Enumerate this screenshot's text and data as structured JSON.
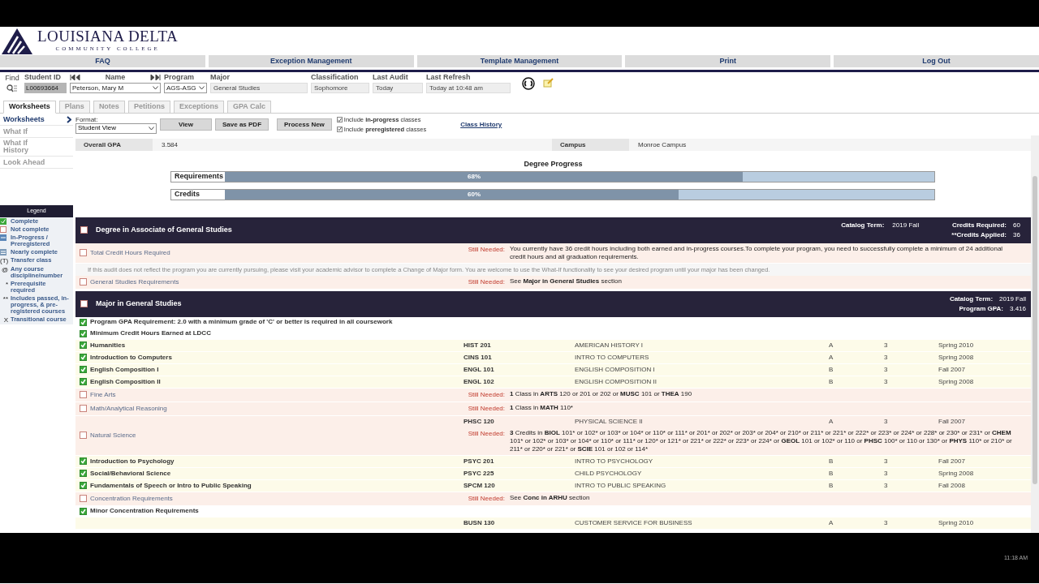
{
  "header": {
    "logo_title": "LOUISIANA DELTA",
    "logo_subtitle": "COMMUNITY COLLEGE"
  },
  "nav": [
    "FAQ",
    "Exception Management",
    "Template Management",
    "Print",
    "Log Out"
  ],
  "student": {
    "find_label": "Find",
    "fields": [
      {
        "label": "Student ID",
        "value": "L00693664",
        "kind": "id"
      },
      {
        "label": "Name",
        "value": "Peterson, Mary M",
        "kind": "select"
      },
      {
        "label": "Program",
        "value": "AGS-ASG",
        "kind": "select"
      },
      {
        "label": "Major",
        "value": "General Studies",
        "kind": "text"
      },
      {
        "label": "Classification",
        "value": "Sophomore",
        "kind": "text"
      },
      {
        "label": "Last Audit",
        "value": "Today",
        "kind": "text"
      },
      {
        "label": "Last Refresh",
        "value": "Today at 10:48 am",
        "kind": "text"
      }
    ]
  },
  "tabs": [
    {
      "label": "Worksheets",
      "selected": true
    },
    {
      "label": "Plans",
      "selected": false
    },
    {
      "label": "Notes",
      "selected": false
    },
    {
      "label": "Petitions",
      "selected": false
    },
    {
      "label": "Exceptions",
      "selected": false
    },
    {
      "label": "GPA Calc",
      "selected": false
    }
  ],
  "side_nav": [
    {
      "label": "Worksheets",
      "selected": true
    },
    {
      "label": "What If",
      "selected": false
    },
    {
      "label": "What If History",
      "selected": false
    },
    {
      "label": "Look Ahead",
      "selected": false
    }
  ],
  "toolbar": {
    "format_label": "Format:",
    "format": "Student View",
    "buttons": [
      "View",
      "Save as PDF",
      "Process New"
    ],
    "options": [
      {
        "text": "Include **in-progress** classes",
        "checked": true
      },
      {
        "text": "Include **preregistered** classes",
        "checked": true
      }
    ],
    "link": "Class History"
  },
  "legend": {
    "title": "Legend",
    "items": [
      {
        "kind": "check",
        "text": "Complete"
      },
      {
        "kind": "box",
        "text": "Not complete"
      },
      {
        "kind": "progress",
        "text": "In-Progress / Preregistered"
      },
      {
        "kind": "nearly",
        "text": "Nearly complete"
      },
      {
        "kind": "symbol",
        "symbol": "(T)",
        "text": "Transfer class"
      },
      {
        "kind": "symbol",
        "symbol": "@",
        "text": "Any course discipline/number"
      },
      {
        "kind": "symbol",
        "symbol": "*",
        "text": "Prerequisite required"
      },
      {
        "kind": "symbol",
        "symbol": "**",
        "text": "Includes passed, in-progress, & pre-registered courses"
      },
      {
        "kind": "symbol",
        "symbol": "X",
        "text": "Transitional course"
      }
    ]
  },
  "summary": [
    {
      "label": "Overall GPA",
      "value": "3.584"
    },
    {
      "label": "Campus",
      "value": "Monroe Campus"
    }
  ],
  "progress": {
    "title": "Degree Progress",
    "bars": [
      {
        "label": "Requirements",
        "level": 0.73,
        "text": "68%"
      },
      {
        "label": "Credits",
        "level": 0.64,
        "text": "60%"
      }
    ]
  },
  "blocks": [
    {
      "title": "Degree in Associate of General Studies",
      "checked": false,
      "meta": [
        {
          "label": "Catalog Term:",
          "value": "2019 Fall"
        }
      ],
      "meta_right": [
        {
          "label": "Credits Required:",
          "value": "60"
        },
        {
          "label": "**Credits Applied:",
          "value": "36"
        }
      ],
      "rows": [
        {
          "kind": "req",
          "checked": false,
          "label": "Total Credit Hours Required",
          "needed_label": "Still Needed:",
          "needed": "You currently have 36 credit hours including both earned and in-progress courses.To complete your program, you need to successfully complete a minimum of 24 additional credit hours and all graduation requirements."
        },
        {
          "kind": "note",
          "text": "If this audit does not reflect the program you are currently pursuing, please visit your academic advisor to complete a Change of Major form. You are welcome to use the What-If functionality to see your desired program until your major has been changed."
        },
        {
          "kind": "req",
          "checked": false,
          "label": "General Studies Requirements",
          "needed_label": "Still Needed:",
          "needed": "See **Major in General Studies** section"
        }
      ]
    },
    {
      "title": "Major in General Studies",
      "checked": false,
      "meta_right": [
        {
          "label": "Catalog Term:",
          "value": "2019 Fall"
        },
        {
          "label": "Program GPA:",
          "value": "3.416"
        }
      ],
      "rows": [
        {
          "kind": "req",
          "checked": true,
          "label": "Program GPA Requirement: 2.0 with a minimum grade of 'C' or better is required in all coursework"
        },
        {
          "kind": "req",
          "checked": true,
          "label": "Minimum Credit Hours Earned at LDCC"
        },
        {
          "kind": "req",
          "checked": true,
          "label": "Humanities",
          "courses": [
            {
              "course": "HIST 201",
              "title": "AMERICAN HISTORY I",
              "grade": "A",
              "credits": "3",
              "term": "Spring 2010"
            }
          ]
        },
        {
          "kind": "req",
          "checked": true,
          "label": "Introduction to Computers",
          "courses": [
            {
              "course": "CINS 101",
              "title": "INTRO TO COMPUTERS",
              "grade": "A",
              "credits": "3",
              "term": "Spring 2008"
            }
          ]
        },
        {
          "kind": "req",
          "checked": true,
          "label": "English Composition I",
          "courses": [
            {
              "course": "ENGL 101",
              "title": "ENGLISH COMPOSITION I",
              "grade": "B",
              "credits": "3",
              "term": "Fall 2007"
            }
          ]
        },
        {
          "kind": "req",
          "checked": true,
          "label": "English Composition II",
          "courses": [
            {
              "course": "ENGL 102",
              "title": "ENGLISH COMPOSITION II",
              "grade": "B",
              "credits": "3",
              "term": "Spring 2008"
            }
          ]
        },
        {
          "kind": "req",
          "checked": false,
          "label": "Fine Arts",
          "needed_label": "Still Needed:",
          "needed": "**1** Class in **ARTS** 120 or 201 or 202 or **MUSC** 101 or **THEA** 190"
        },
        {
          "kind": "req",
          "checked": false,
          "label": "Math/Analytical Reasoning",
          "needed_label": "Still Needed:",
          "needed": "**1** Class in **MATH** 110*"
        },
        {
          "kind": "req",
          "checked": false,
          "label": "Natural Science",
          "courses": [
            {
              "course": "PHSC 120",
              "title": "PHYSICAL SCIENCE II",
              "grade": "A",
              "credits": "3",
              "term": "Fall 2007"
            }
          ],
          "needed_label": "Still Needed:",
          "needed": "**3** Credits in **BIOL** 101* or 102* or 103* or 104* or 110* or 111* or 201* or 202* or 203* or 204* or 210* or 211* or 221* or 222* or 223* or 224* or 228* or 230* or 231* or **CHEM** 101* or 102* or 103* or 104* or 110* or 111* or 120* or 121* or 221* or 222* or 223* or 224* or **GEOL** 101 or 102* or 110 or **PHSC** 100* or 110 or 130* or **PHYS** 110* or 210* or 211* or 220* or 221* or **SCIE** 101 or 102 or 114*"
        },
        {
          "kind": "req",
          "checked": true,
          "label": "Introduction to Psychology",
          "courses": [
            {
              "course": "PSYC 201",
              "title": "INTRO TO PSYCHOLOGY",
              "grade": "B",
              "credits": "3",
              "term": "Fall 2007"
            }
          ]
        },
        {
          "kind": "req",
          "checked": true,
          "label": "Social/Behavioral Science",
          "courses": [
            {
              "course": "PSYC 225",
              "title": "CHILD PSYCHOLOGY",
              "grade": "B",
              "credits": "3",
              "term": "Spring 2008"
            }
          ]
        },
        {
          "kind": "req",
          "checked": true,
          "label": "Fundamentals of Speech or Intro to Public Speaking",
          "courses": [
            {
              "course": "SPCM 120",
              "title": "INTRO TO PUBLIC SPEAKING",
              "grade": "B",
              "credits": "3",
              "term": "Fall 2008"
            }
          ]
        },
        {
          "kind": "req",
          "checked": false,
          "label": "Concentration Requirements",
          "needed_label": "Still Needed:",
          "needed": "See **Conc in ARHU** section"
        },
        {
          "kind": "req",
          "checked": true,
          "label": "Minor Concentration Requirements"
        },
        {
          "kind": "course_only",
          "courses": [
            {
              "course": "BUSN 130",
              "title": "CUSTOMER SERVICE FOR BUSINESS",
              "grade": "A",
              "credits": "3",
              "term": "Spring 2010"
            }
          ]
        }
      ]
    }
  ],
  "taskbar_clock": "11:18 AM"
}
